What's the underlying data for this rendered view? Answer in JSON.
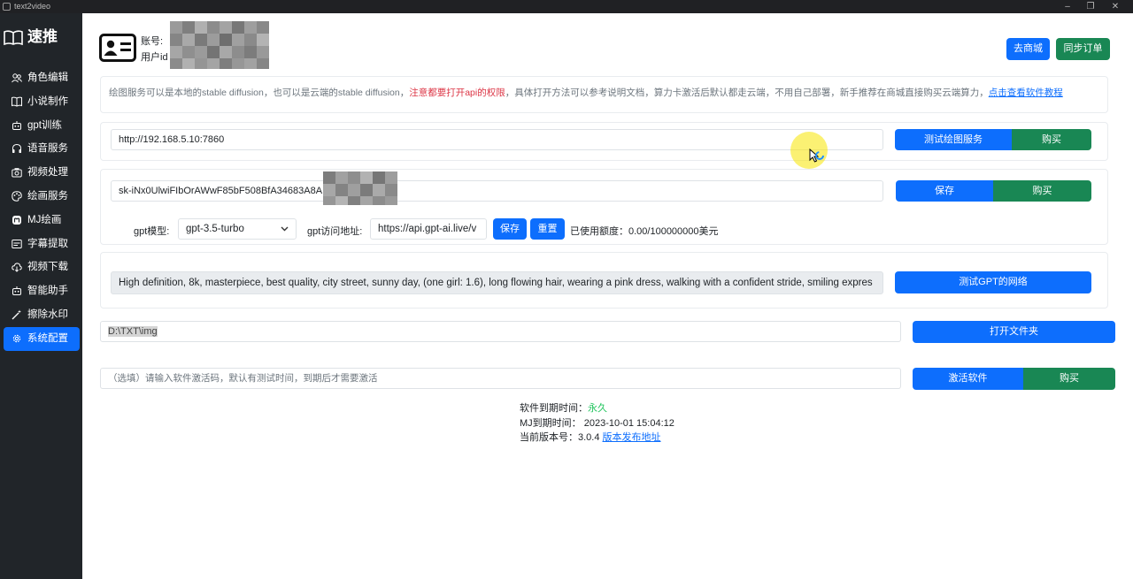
{
  "window": {
    "title": "text2video"
  },
  "brand": {
    "name": "速推"
  },
  "sidebar": {
    "items": [
      {
        "label": "角色编辑",
        "icon": "users-icon"
      },
      {
        "label": "小说制作",
        "icon": "book-icon"
      },
      {
        "label": "gpt训练",
        "icon": "robot-icon"
      },
      {
        "label": "语音服务",
        "icon": "headphones-icon"
      },
      {
        "label": "视频处理",
        "icon": "camera-icon"
      },
      {
        "label": "绘画服务",
        "icon": "palette-icon"
      },
      {
        "label": "MJ绘画",
        "icon": "mastodon-icon"
      },
      {
        "label": "字幕提取",
        "icon": "subtitle-icon"
      },
      {
        "label": "视频下载",
        "icon": "cloud-download-icon"
      },
      {
        "label": "智能助手",
        "icon": "robot-icon"
      },
      {
        "label": "擦除水印",
        "icon": "magic-wand-icon"
      },
      {
        "label": "系统配置",
        "icon": "gear-icon",
        "active": true
      }
    ]
  },
  "account": {
    "account_label": "账号:",
    "user_id_label": "用户id"
  },
  "header": {
    "shop_button": "去商城",
    "sync_button": "同步订单"
  },
  "notice": {
    "text_before": "绘图服务可以是本地的stable diffusion，也可以是云端的stable diffusion，",
    "text_warning": "注意都要打开api的权限",
    "text_after": "，具体打开方法可以参考说明文档，算力卡激活后默认都走云端，不用自己部署，新手推荐在商城直接购买云端算力，",
    "link": "点击查看软件教程"
  },
  "draw_service": {
    "url_value": "http://192.168.5.10:7860",
    "test_button": "测试绘图服务",
    "buy_button": "购买"
  },
  "api_key": {
    "value": "sk-iNx0UlwiFIbOrAWwF85bF508BfA34683A8A",
    "save_button": "保存",
    "buy_button": "购买"
  },
  "gpt": {
    "model_label": "gpt模型:",
    "model_value": "gpt-3.5-turbo",
    "address_label": "gpt访问地址:",
    "address_value": "https://api.gpt-ai.live/v",
    "save_button": "保存",
    "reset_button": "重置",
    "usage_text": "已使用额度：0.00/100000000美元"
  },
  "prompt_test": {
    "value": "High definition, 8k, masterpiece, best quality, city street, sunny day, (one girl: 1.6), long flowing hair, wearing a pink dress, walking with a confident stride, smiling expres",
    "test_button": "测试GPT的网络"
  },
  "folder": {
    "value": "D:\\TXT\\img",
    "open_button": "打开文件夹"
  },
  "activation": {
    "placeholder": "（选填）请输入软件激活码，默认有测试时间，到期后才需要激活",
    "activate_button": "激活软件",
    "buy_button": "购买"
  },
  "footer": {
    "expire_label": "软件到期时间：",
    "expire_value": "永久",
    "mj_expire": "MJ到期时间：  2023-10-01 15:04:12",
    "version_label": "当前版本号：3.0.4",
    "version_link": "版本发布地址"
  },
  "colors": {
    "primary": "#0d6efd",
    "success": "#198754",
    "sidebar_bg": "#212529",
    "warning_text": "#dc3545",
    "forever_green": "#22c55e"
  }
}
